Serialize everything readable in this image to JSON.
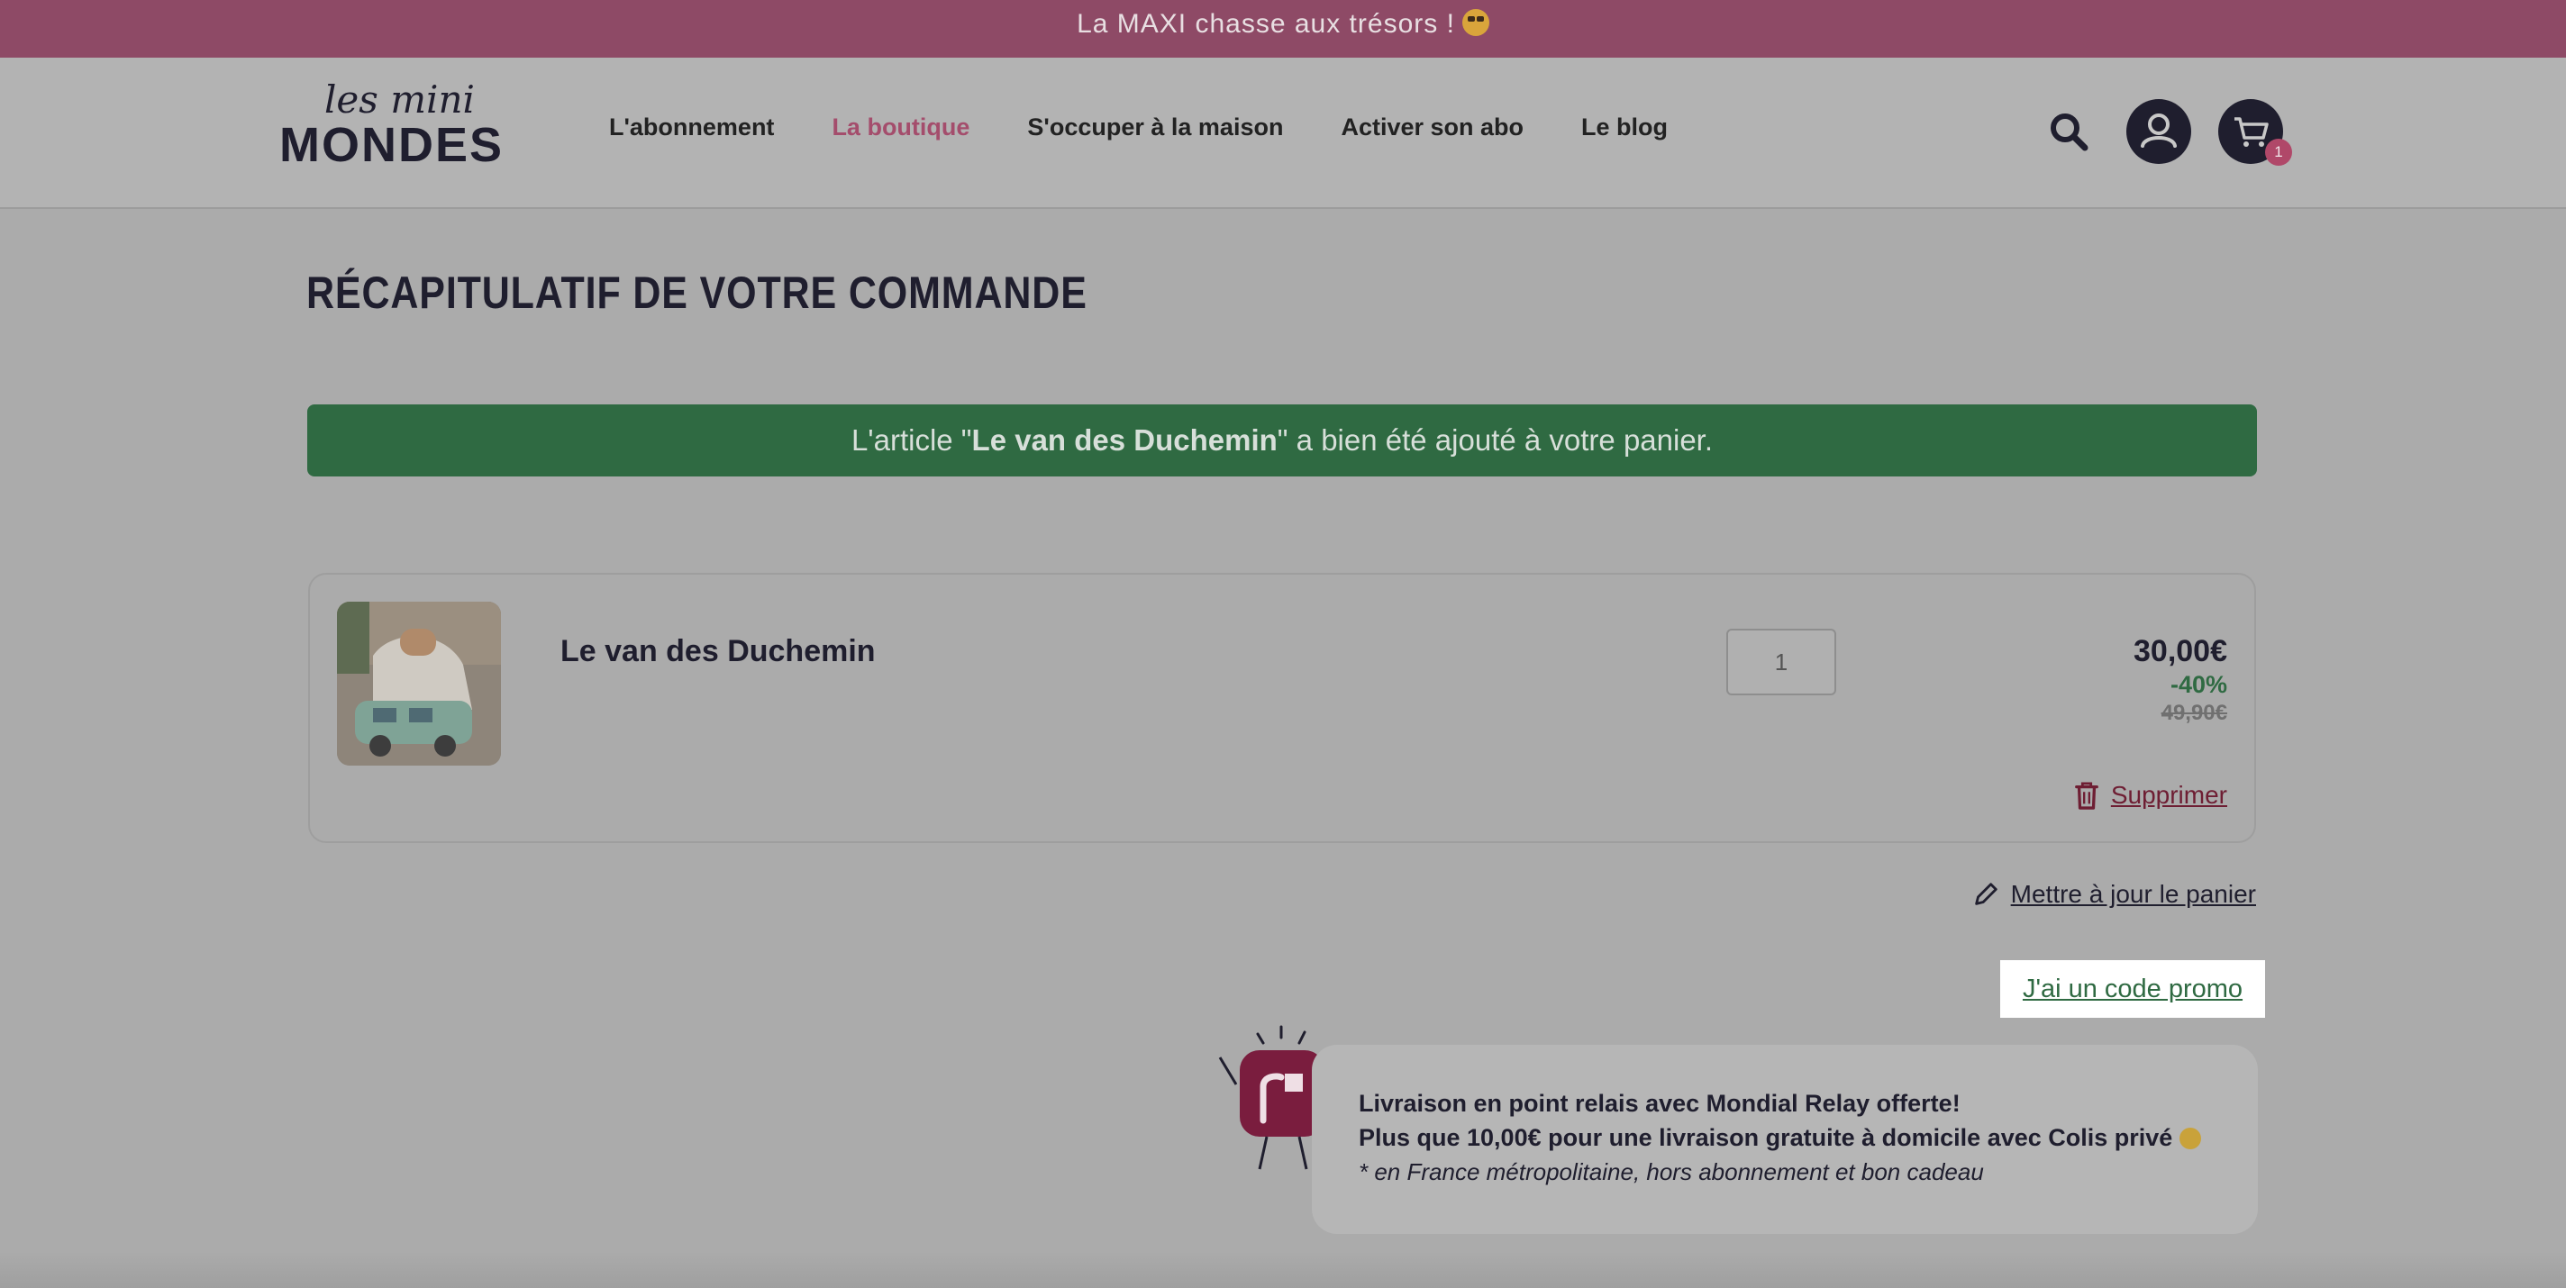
{
  "banner": {
    "text": "La MAXI chasse aux trésors !",
    "emoji": "grinning-face-emoji"
  },
  "header": {
    "logo_line1": "les mini",
    "logo_line2": "MONDES",
    "nav": [
      {
        "label": "L'abonnement",
        "active": false
      },
      {
        "label": "La boutique",
        "active": true
      },
      {
        "label": "S'occuper à la maison",
        "active": false
      },
      {
        "label": "Activer son abo",
        "active": false
      },
      {
        "label": "Le blog",
        "active": false
      }
    ],
    "icons": [
      "search-icon",
      "account-icon",
      "cart-icon"
    ],
    "cart_count": "1"
  },
  "page": {
    "title": "RÉCAPITULATIF DE VOTRE COMMANDE"
  },
  "notice": {
    "prefix": "L'article \"",
    "item": "Le van des Duchemin",
    "suffix": "\" a bien été ajouté à votre panier."
  },
  "cart": {
    "item": {
      "name": "Le van des Duchemin",
      "quantity": "1",
      "price": "30,00€",
      "discount": "-40%",
      "old_price": "49,90€",
      "remove_label": "Supprimer"
    },
    "update_label": "Mettre à jour le panier",
    "promo_label": "J'ai un code promo"
  },
  "shipping": {
    "line1": "Livraison en point relais avec Mondial Relay offerte!",
    "line2": "Plus que 10,00€ pour une livraison gratuite à domicile avec Colis privé",
    "line3": "* en France métropolitaine, hors abonnement et bon cadeau"
  },
  "colors": {
    "banner_bg": "#8e4a66",
    "accent_pink": "#a44d6c",
    "success_green": "#2f6a42",
    "dark_navy": "#1f1e2e",
    "remove_red": "#6e1e33"
  }
}
